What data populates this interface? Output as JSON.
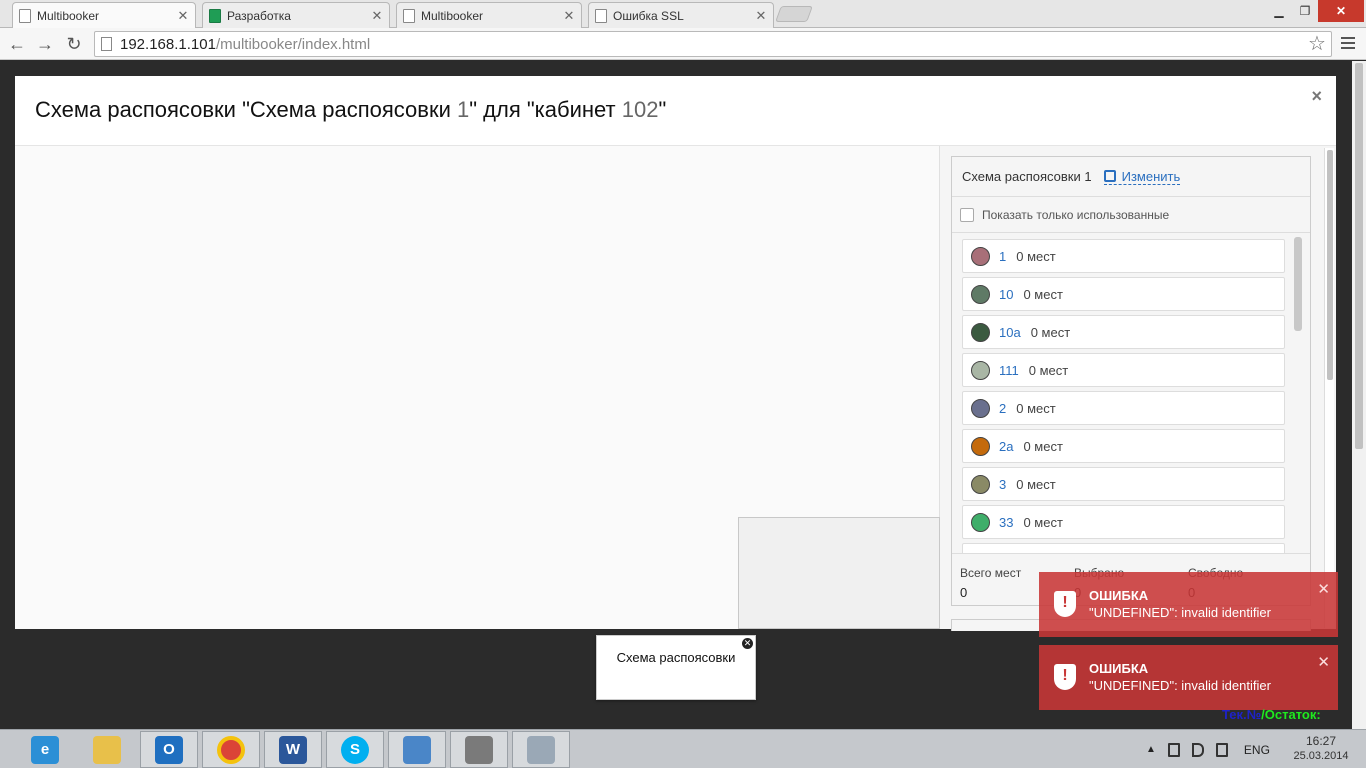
{
  "browser": {
    "tabs": [
      {
        "title": "Multibooker",
        "active": true,
        "icon": "page-icon"
      },
      {
        "title": "Разработка",
        "active": false,
        "icon": "sheets-icon"
      },
      {
        "title": "Multibooker",
        "active": false,
        "icon": "page-icon"
      },
      {
        "title": "Ошибка SSL",
        "active": false,
        "icon": "page-icon"
      }
    ],
    "url_host": "192.168.1.101",
    "url_path": "/multibooker/index.html"
  },
  "modal": {
    "title_prefix": "Схема распоясовки \"Схема распоясовки ",
    "title_scheme_num": "1",
    "title_middle": "\" для \"кабинет ",
    "title_room_num": "102",
    "title_suffix": "\"",
    "close": "×"
  },
  "panel": {
    "scheme_name": "Схема распоясовки 1",
    "edit_label": "Изменить",
    "filter_label": "Показать только использованные",
    "items": [
      {
        "label": "1",
        "seats": "0 мест",
        "color": "#a86f78"
      },
      {
        "label": "10",
        "seats": "0 мест",
        "color": "#5f7a66"
      },
      {
        "label": "10а",
        "seats": "0 мест",
        "color": "#3b5a40"
      },
      {
        "label": "111",
        "seats": "0 мест",
        "color": "#a9b6a5"
      },
      {
        "label": "2",
        "seats": "0 мест",
        "color": "#6a708e"
      },
      {
        "label": "2а",
        "seats": "0 мест",
        "color": "#c46a0c"
      },
      {
        "label": "3",
        "seats": "0 мест",
        "color": "#8a8a66"
      },
      {
        "label": "33",
        "seats": "0 мест",
        "color": "#3fae6a"
      }
    ],
    "stats": {
      "total_label": "Всего мест",
      "total_value": "0",
      "selected_label": "Выбрано",
      "selected_value": "0",
      "free_label": "Свободно",
      "free_value": "0"
    }
  },
  "popup": {
    "label": "Схема распоясовки"
  },
  "toasts": [
    {
      "title": "Ошибка",
      "message": "\"UNDEFINED\": invalid identifier"
    },
    {
      "title": "Ошибка",
      "message": "\"UNDEFINED\": invalid identifier"
    }
  ],
  "footer": {
    "tek": "Тек.№",
    "separator": "/",
    "remaining": "Остаток:"
  },
  "taskbar": {
    "apps": [
      "internet-explorer",
      "file-explorer",
      "outlook",
      "chrome",
      "word",
      "skype",
      "remote-desktop",
      "firewall",
      "monitor"
    ],
    "lang": "ENG",
    "time": "16:27",
    "date": "25.03.2014"
  }
}
